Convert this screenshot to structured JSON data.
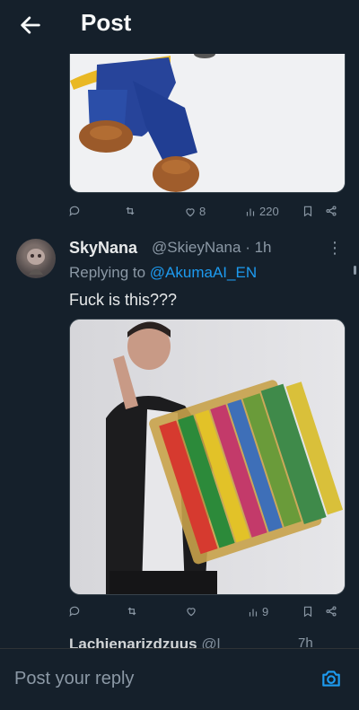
{
  "header": {
    "title": "Post"
  },
  "first_post": {
    "actions": {
      "likes": "8",
      "views": "220"
    }
  },
  "reply_post": {
    "display_name": "SkyNana",
    "handle": "@SkieyNana",
    "time": "1h",
    "replying_to_prefix": "Replying to",
    "replying_to_handle": "@AkumaAI_EN",
    "text": "Fuck is this???",
    "actions": {
      "views": "9"
    }
  },
  "next_post": {
    "display_name": "Lachienarizdzuus",
    "handle": "@l",
    "time": "7h"
  },
  "composer": {
    "placeholder": "Post your reply"
  },
  "colors": {
    "background": "#15202b",
    "accent": "#1d9bf0",
    "muted": "#8b98a5"
  }
}
